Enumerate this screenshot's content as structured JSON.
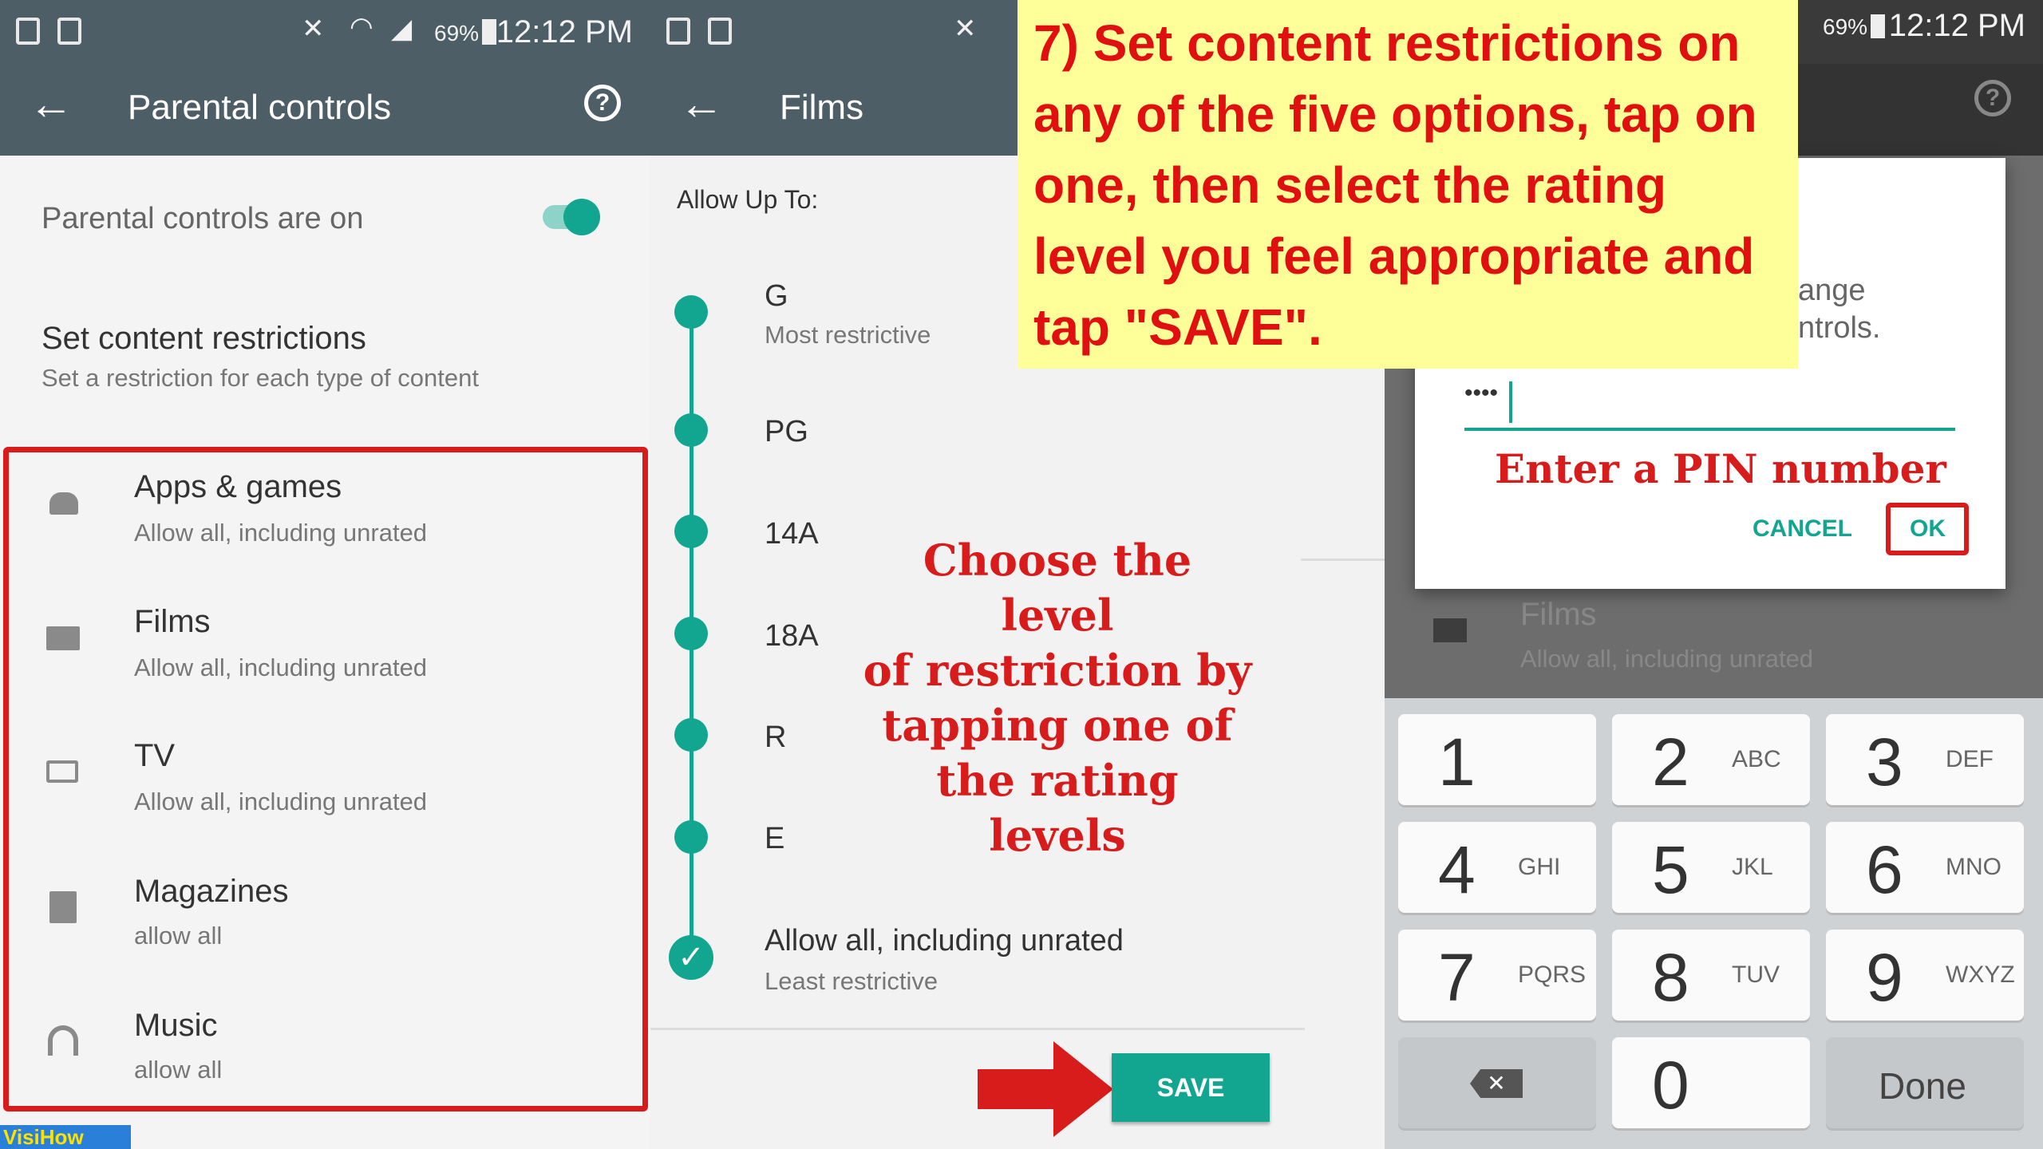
{
  "panel1": {
    "status": {
      "battery": "69%",
      "time": "12:12 PM"
    },
    "title": "Parental controls",
    "toggle_label": "Parental controls are on",
    "section_title": "Set content restrictions",
    "section_sub": "Set a restriction for each type of content",
    "items": [
      {
        "label": "Apps & games",
        "sub": "Allow all, including unrated",
        "icon": "android-icon"
      },
      {
        "label": "Films",
        "sub": "Allow all, including unrated",
        "icon": "film-icon"
      },
      {
        "label": "TV",
        "sub": "Allow all, including unrated",
        "icon": "tv-icon"
      },
      {
        "label": "Magazines",
        "sub": "allow all",
        "icon": "magazine-icon"
      },
      {
        "label": "Music",
        "sub": "allow all",
        "icon": "headphones-icon"
      }
    ],
    "watermark": "VisiHow"
  },
  "panel2": {
    "title": "Films",
    "allow_up_to": "Allow Up To:",
    "ratings": [
      {
        "label": "G",
        "sub": "Most restrictive"
      },
      {
        "label": "PG",
        "sub": ""
      },
      {
        "label": "14A",
        "sub": ""
      },
      {
        "label": "18A",
        "sub": ""
      },
      {
        "label": "R",
        "sub": ""
      },
      {
        "label": "E",
        "sub": ""
      },
      {
        "label": "Allow all, including unrated",
        "sub": "Least restrictive"
      }
    ],
    "selected_index": 6,
    "annotation": [
      "Choose the level",
      "of restriction by",
      "tapping one of",
      "the rating levels"
    ],
    "save": "SAVE"
  },
  "panel3": {
    "status": {
      "battery": "69%",
      "time": "12:12 PM"
    },
    "dialog_partial_1": "ange",
    "dialog_partial_2": "ntrols.",
    "pin_value": "••••",
    "pin_annotation": "Enter a PIN number",
    "cancel": "CANCEL",
    "ok": "OK",
    "bg_item_label": "Films",
    "bg_item_sub": "Allow all, including unrated",
    "keys": [
      {
        "num": "1",
        "letters": ""
      },
      {
        "num": "2",
        "letters": "ABC"
      },
      {
        "num": "3",
        "letters": "DEF"
      },
      {
        "num": "4",
        "letters": "GHI"
      },
      {
        "num": "5",
        "letters": "JKL"
      },
      {
        "num": "6",
        "letters": "MNO"
      },
      {
        "num": "7",
        "letters": "PQRS"
      },
      {
        "num": "8",
        "letters": "TUV"
      },
      {
        "num": "9",
        "letters": "WXYZ"
      },
      {
        "num": "0",
        "letters": ""
      }
    ],
    "done": "Done"
  },
  "callout": {
    "lines": [
      "7) Set content restrictions on",
      "any of the five options, tap on",
      "one, then select the rating",
      "level you feel appropriate and",
      "tap \"SAVE\"."
    ]
  },
  "colors": {
    "accent": "#12a58f",
    "appbar": "#4d5e66",
    "annotation_red": "#d81b1b",
    "callout_bg": "#ffff99"
  }
}
